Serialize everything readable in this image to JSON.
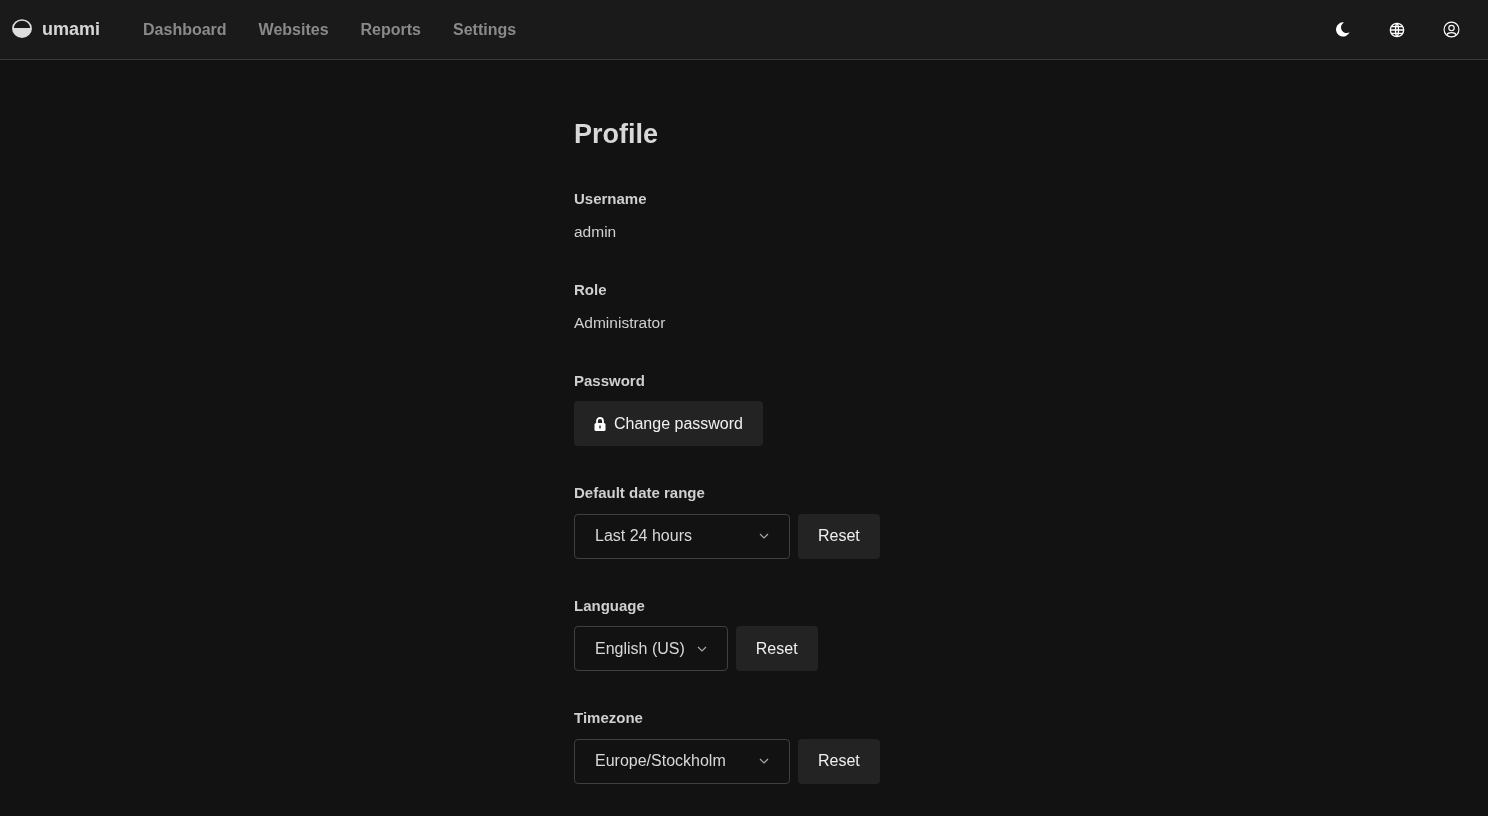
{
  "brand": {
    "name": "umami"
  },
  "nav": [
    {
      "label": "Dashboard",
      "selected": false
    },
    {
      "label": "Websites",
      "selected": false
    },
    {
      "label": "Reports",
      "selected": false
    },
    {
      "label": "Settings",
      "selected": false
    }
  ],
  "title": "Profile",
  "fields": [
    {
      "kind": "text",
      "label": "Username",
      "value": "admin"
    },
    {
      "kind": "text",
      "label": "Role",
      "value": "Administrator"
    },
    {
      "kind": "button",
      "label": "Password",
      "button": "Change password"
    },
    {
      "kind": "select",
      "label": "Default date range",
      "value": "Last 24 hours",
      "reset": "Reset",
      "wide": true
    },
    {
      "kind": "select",
      "label": "Language",
      "value": "English (US)",
      "reset": "Reset",
      "wide": false
    },
    {
      "kind": "select",
      "label": "Timezone",
      "value": "Europe/Stockholm",
      "reset": "Reset",
      "wide": true
    }
  ]
}
